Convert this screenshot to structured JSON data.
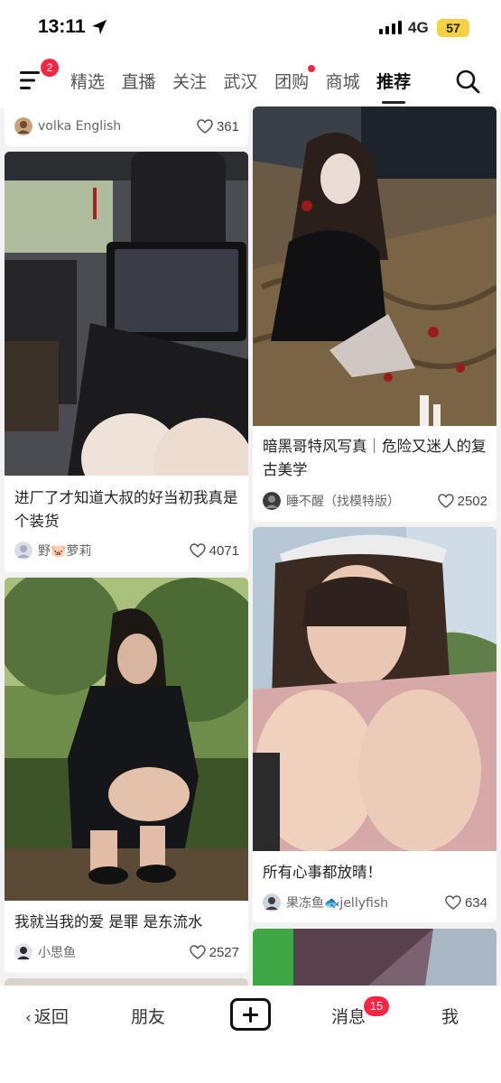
{
  "status_bar": {
    "time": "13:11",
    "network": "4G",
    "battery": "57"
  },
  "top_nav": {
    "menu_badge": "2",
    "tabs": [
      {
        "label": "精选"
      },
      {
        "label": "直播"
      },
      {
        "label": "关注"
      },
      {
        "label": "武汉"
      },
      {
        "label": "团购",
        "dot": true
      },
      {
        "label": "商城"
      },
      {
        "label": "推荐",
        "active": true
      }
    ]
  },
  "feed": {
    "left": [
      {
        "author": "volka English",
        "likes": "361"
      },
      {
        "title": "进厂了才知道大叔的好当初我真是个装货",
        "author": "野🐷萝莉",
        "likes": "4071"
      },
      {
        "title": "我就当我的爱 是罪 是东流水",
        "author": "小思鱼",
        "likes": "2527"
      }
    ],
    "right": [
      {
        "title": "暗黑哥特风写真｜危险又迷人的复古美学",
        "author": "睡不醒（找模特版）",
        "likes": "2502"
      },
      {
        "title": "所有心事都放晴！",
        "author": "果冻鱼🐟jellyfish",
        "likes": "634"
      }
    ]
  },
  "bottom_bar": {
    "back": "返回",
    "friends": "朋友",
    "messages": "消息",
    "messages_badge": "15",
    "me": "我"
  },
  "colors": {
    "accent": "#ff2442",
    "battery": "#f5d142"
  }
}
